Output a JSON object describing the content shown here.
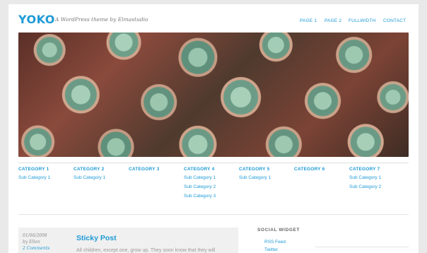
{
  "site": {
    "title": "YOKO",
    "tagline": "A WordPress theme by Elmastudio"
  },
  "nav": {
    "items": [
      "PAGE 1",
      "PAGE 2",
      "FULLWIDTH",
      "CONTACT"
    ]
  },
  "hero": {
    "description": "header-image-succulents"
  },
  "categories": [
    {
      "title": "CATEGORY 1",
      "subs": [
        "Sub Category 1"
      ]
    },
    {
      "title": "CATEGORY 2",
      "subs": [
        "Sub Category 1"
      ]
    },
    {
      "title": "CATEGORY 3",
      "subs": []
    },
    {
      "title": "CATEGORY 4",
      "subs": [
        "Sub Category 1",
        "Sub Category 2",
        "Sub Category 3"
      ]
    },
    {
      "title": "CATEGORY 5",
      "subs": [
        "Sub Category 1"
      ]
    },
    {
      "title": "CATEGORY 6",
      "subs": []
    },
    {
      "title": "CATEGORY 7",
      "subs": [
        "Sub Category 1",
        "Sub Category 2"
      ]
    }
  ],
  "post": {
    "date": "01/06/2008",
    "author": "by Ellen",
    "comments": "2 Comments",
    "title": "Sticky Post",
    "excerpt": "All children, except one, grow up. They soon know that they will"
  },
  "sidebar": {
    "widget_title": "SOCIAL WIDGET",
    "links": [
      "RSS Feed",
      "Twitter"
    ]
  },
  "colors": {
    "accent": "#1e9ad6",
    "background": "#e9e9e9",
    "post_bg": "#f0f0f0"
  }
}
